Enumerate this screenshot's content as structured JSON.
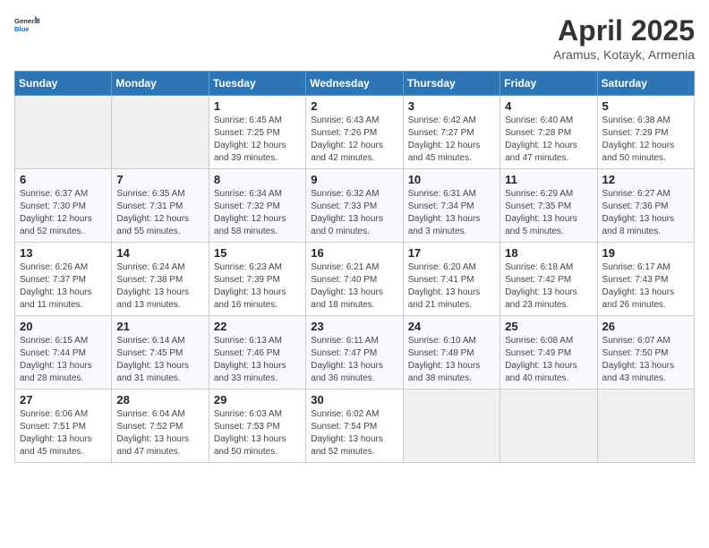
{
  "header": {
    "logo_general": "General",
    "logo_blue": "Blue",
    "month_title": "April 2025",
    "location": "Aramus, Kotayk, Armenia"
  },
  "days_of_week": [
    "Sunday",
    "Monday",
    "Tuesday",
    "Wednesday",
    "Thursday",
    "Friday",
    "Saturday"
  ],
  "weeks": [
    [
      {
        "day": "",
        "info": ""
      },
      {
        "day": "",
        "info": ""
      },
      {
        "day": "1",
        "info": "Sunrise: 6:45 AM\nSunset: 7:25 PM\nDaylight: 12 hours and 39 minutes."
      },
      {
        "day": "2",
        "info": "Sunrise: 6:43 AM\nSunset: 7:26 PM\nDaylight: 12 hours and 42 minutes."
      },
      {
        "day": "3",
        "info": "Sunrise: 6:42 AM\nSunset: 7:27 PM\nDaylight: 12 hours and 45 minutes."
      },
      {
        "day": "4",
        "info": "Sunrise: 6:40 AM\nSunset: 7:28 PM\nDaylight: 12 hours and 47 minutes."
      },
      {
        "day": "5",
        "info": "Sunrise: 6:38 AM\nSunset: 7:29 PM\nDaylight: 12 hours and 50 minutes."
      }
    ],
    [
      {
        "day": "6",
        "info": "Sunrise: 6:37 AM\nSunset: 7:30 PM\nDaylight: 12 hours and 52 minutes."
      },
      {
        "day": "7",
        "info": "Sunrise: 6:35 AM\nSunset: 7:31 PM\nDaylight: 12 hours and 55 minutes."
      },
      {
        "day": "8",
        "info": "Sunrise: 6:34 AM\nSunset: 7:32 PM\nDaylight: 12 hours and 58 minutes."
      },
      {
        "day": "9",
        "info": "Sunrise: 6:32 AM\nSunset: 7:33 PM\nDaylight: 13 hours and 0 minutes."
      },
      {
        "day": "10",
        "info": "Sunrise: 6:31 AM\nSunset: 7:34 PM\nDaylight: 13 hours and 3 minutes."
      },
      {
        "day": "11",
        "info": "Sunrise: 6:29 AM\nSunset: 7:35 PM\nDaylight: 13 hours and 5 minutes."
      },
      {
        "day": "12",
        "info": "Sunrise: 6:27 AM\nSunset: 7:36 PM\nDaylight: 13 hours and 8 minutes."
      }
    ],
    [
      {
        "day": "13",
        "info": "Sunrise: 6:26 AM\nSunset: 7:37 PM\nDaylight: 13 hours and 11 minutes."
      },
      {
        "day": "14",
        "info": "Sunrise: 6:24 AM\nSunset: 7:38 PM\nDaylight: 13 hours and 13 minutes."
      },
      {
        "day": "15",
        "info": "Sunrise: 6:23 AM\nSunset: 7:39 PM\nDaylight: 13 hours and 16 minutes."
      },
      {
        "day": "16",
        "info": "Sunrise: 6:21 AM\nSunset: 7:40 PM\nDaylight: 13 hours and 18 minutes."
      },
      {
        "day": "17",
        "info": "Sunrise: 6:20 AM\nSunset: 7:41 PM\nDaylight: 13 hours and 21 minutes."
      },
      {
        "day": "18",
        "info": "Sunrise: 6:18 AM\nSunset: 7:42 PM\nDaylight: 13 hours and 23 minutes."
      },
      {
        "day": "19",
        "info": "Sunrise: 6:17 AM\nSunset: 7:43 PM\nDaylight: 13 hours and 26 minutes."
      }
    ],
    [
      {
        "day": "20",
        "info": "Sunrise: 6:15 AM\nSunset: 7:44 PM\nDaylight: 13 hours and 28 minutes."
      },
      {
        "day": "21",
        "info": "Sunrise: 6:14 AM\nSunset: 7:45 PM\nDaylight: 13 hours and 31 minutes."
      },
      {
        "day": "22",
        "info": "Sunrise: 6:13 AM\nSunset: 7:46 PM\nDaylight: 13 hours and 33 minutes."
      },
      {
        "day": "23",
        "info": "Sunrise: 6:11 AM\nSunset: 7:47 PM\nDaylight: 13 hours and 36 minutes."
      },
      {
        "day": "24",
        "info": "Sunrise: 6:10 AM\nSunset: 7:48 PM\nDaylight: 13 hours and 38 minutes."
      },
      {
        "day": "25",
        "info": "Sunrise: 6:08 AM\nSunset: 7:49 PM\nDaylight: 13 hours and 40 minutes."
      },
      {
        "day": "26",
        "info": "Sunrise: 6:07 AM\nSunset: 7:50 PM\nDaylight: 13 hours and 43 minutes."
      }
    ],
    [
      {
        "day": "27",
        "info": "Sunrise: 6:06 AM\nSunset: 7:51 PM\nDaylight: 13 hours and 45 minutes."
      },
      {
        "day": "28",
        "info": "Sunrise: 6:04 AM\nSunset: 7:52 PM\nDaylight: 13 hours and 47 minutes."
      },
      {
        "day": "29",
        "info": "Sunrise: 6:03 AM\nSunset: 7:53 PM\nDaylight: 13 hours and 50 minutes."
      },
      {
        "day": "30",
        "info": "Sunrise: 6:02 AM\nSunset: 7:54 PM\nDaylight: 13 hours and 52 minutes."
      },
      {
        "day": "",
        "info": ""
      },
      {
        "day": "",
        "info": ""
      },
      {
        "day": "",
        "info": ""
      }
    ]
  ]
}
